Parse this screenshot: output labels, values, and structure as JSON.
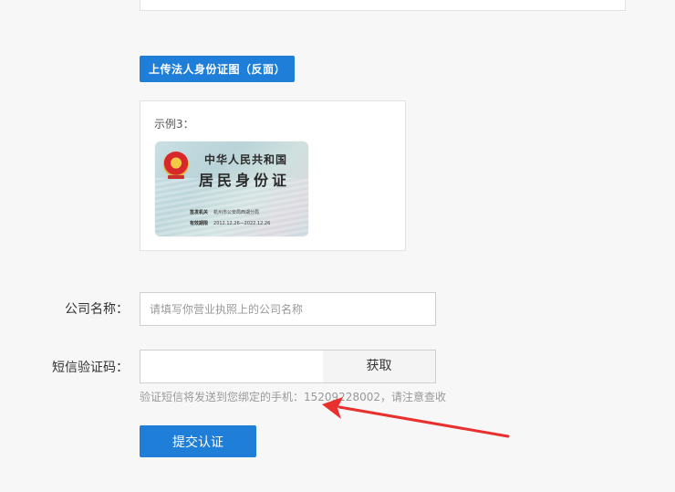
{
  "upload": {
    "button_label": "上传法人身份证图（反面）"
  },
  "sample": {
    "label": "示例3：",
    "card": {
      "title_line1": "中华人民共和国",
      "title_line2": "居民身份证",
      "authority_label": "签发机关",
      "authority_value": "杭州市公安局西湖分局",
      "validity_label": "有效期限",
      "validity_value": "2012.12.26—2022.12.26"
    }
  },
  "company": {
    "label": "公司名称：",
    "placeholder": "请填写你营业执照上的公司名称"
  },
  "sms": {
    "label": "短信验证码：",
    "value": "",
    "get_button": "获取",
    "hint": "验证短信将发送到您绑定的手机：15209228002，请注意查收"
  },
  "submit": {
    "label": "提交认证"
  },
  "colors": {
    "primary": "#1e7ed8",
    "arrow": "#e8302e"
  }
}
